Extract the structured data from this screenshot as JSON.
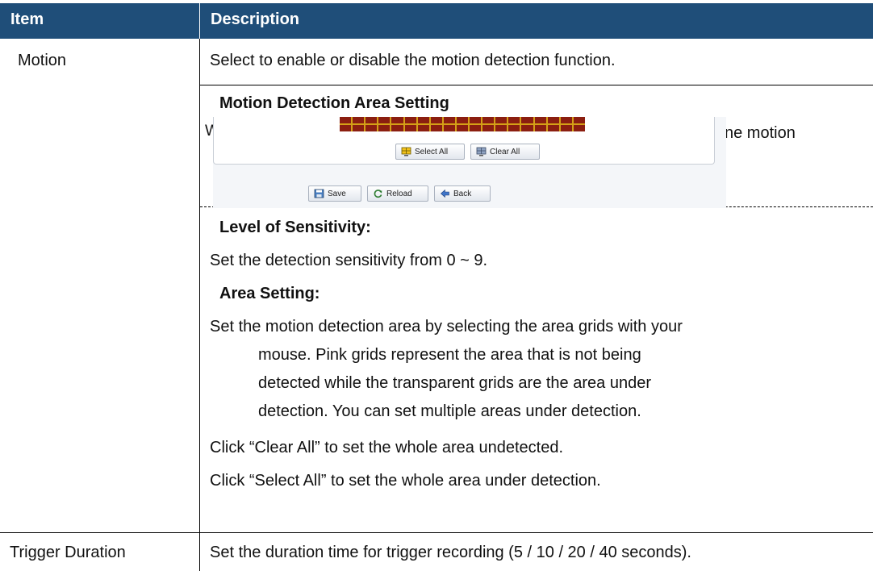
{
  "header": {
    "item": "Item",
    "description": "Description"
  },
  "rows": [
    {
      "item": "Motion",
      "intro": "Select to enable or disable the motion detection function.",
      "area_heading": "Motion Detection Area Setting",
      "covered_left": "W",
      "covered_right": "ne motion",
      "sensitivity_heading": "Level of Sensitivity:",
      "sensitivity_text": "Set the detection sensitivity from 0 ~ 9.",
      "area_setting_heading": "Area Setting:",
      "area_lines": [
        "Set the motion detection area by selecting the area grids with your",
        "mouse. Pink grids represent the area that is not being",
        "detected while the transparent grids are the area under",
        "detection. You can set multiple areas under detection."
      ],
      "clear_all_note": "Click “Clear All” to set the whole area undetected.",
      "select_all_note": "Click “Select All” to set the whole area under detection."
    },
    {
      "item": "Trigger Duration",
      "description": "Set the duration time for trigger recording (5 / 10 / 20 / 40 seconds)."
    }
  ],
  "screenshot": {
    "select_all": "Select All",
    "clear_all": "Clear All",
    "save": "Save",
    "reload": "Reload",
    "back": "Back",
    "icons": [
      "select-all-icon",
      "clear-all-icon",
      "save-icon",
      "reload-icon",
      "back-icon"
    ],
    "grid_colors": {
      "cell": "#8b1e10",
      "border": "#d4a017"
    }
  },
  "colors": {
    "header_bg": "#1f4e79",
    "header_text": "#ffffff"
  }
}
